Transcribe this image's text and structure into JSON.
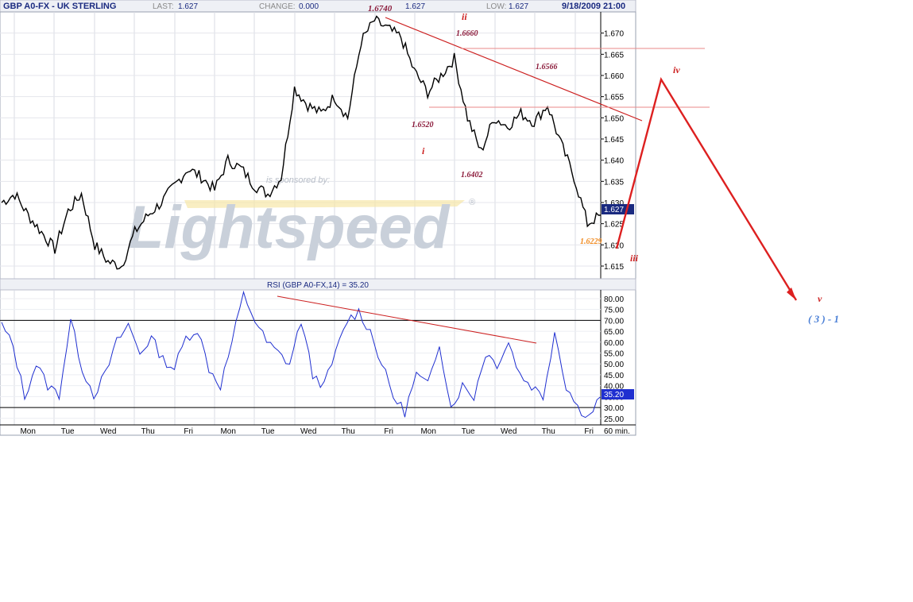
{
  "header": {
    "title": "GBP A0-FX - UK STERLING",
    "last_label": "LAST:",
    "last_value": "1.627",
    "change_label": "CHANGE:",
    "change_value": "0.000",
    "high_value": "1.627",
    "low_label": "LOW:",
    "low_value": "1.627",
    "datetime": "9/18/2009 21:00"
  },
  "watermark": {
    "text": "Lightspeed",
    "sponsored": "is sponsored by:",
    "reg": "®"
  },
  "price_axis": {
    "ticks": [
      "1.670",
      "1.665",
      "1.660",
      "1.655",
      "1.650",
      "1.645",
      "1.640",
      "1.635",
      "1.630",
      "1.625",
      "1.620",
      "1.615"
    ],
    "last_badge": "1.627"
  },
  "rsi": {
    "title": "RSI (GBP A0-FX,14) = 35.20",
    "ticks": [
      "80.00",
      "75.00",
      "70.00",
      "65.00",
      "60.00",
      "55.00",
      "50.00",
      "45.00",
      "40.00",
      "35.00",
      "30.00",
      "25.00"
    ],
    "badge": "35.20"
  },
  "days": [
    "Mon",
    "Tue",
    "Wed",
    "Thu",
    "Fri",
    "Mon",
    "Tue",
    "Wed",
    "Thu",
    "Fri",
    "Mon",
    "Tue",
    "Wed",
    "Thu",
    "Fri"
  ],
  "interval": "60 min.",
  "annotations": {
    "p1": "1.6740",
    "p2": "1.6660",
    "p3": "1.6566",
    "p4": "1.6520",
    "p5": "1.6402",
    "p6": "1.6229",
    "w_i": "i",
    "w_ii": "ii",
    "w_iii": "iii",
    "w_iv": "iv",
    "w_v": "v",
    "target": "( 3 ) - 1"
  },
  "colors": {
    "price": "#000000",
    "rsi": "#1f2fd0",
    "trend": "#cc1f1f",
    "badge": "#1a2a80"
  },
  "chart_data": [
    {
      "type": "line",
      "title": "GBP A0-FX - UK STERLING",
      "interval": "60 min.",
      "ylim": [
        1.612,
        1.675
      ],
      "x": [
        "Mon",
        "Tue",
        "Wed",
        "Thu",
        "Fri",
        "Mon",
        "Tue",
        "Wed",
        "Thu",
        "Fri",
        "Mon",
        "Tue",
        "Wed",
        "Thu",
        "Fri"
      ],
      "series": [
        {
          "values": [
            1.63,
            1.632,
            1.627,
            1.623,
            1.619,
            1.628,
            1.632,
            1.62,
            1.616,
            1.615,
            1.623,
            1.627,
            1.63,
            1.634,
            1.638,
            1.636,
            1.633,
            1.64,
            1.638,
            1.634,
            1.632,
            1.636,
            1.657,
            1.653,
            1.651,
            1.655,
            1.65,
            1.668,
            1.673,
            1.671,
            1.669,
            1.661,
            1.656,
            1.66,
            1.664,
            1.65,
            1.642,
            1.65,
            1.648,
            1.651,
            1.649,
            1.653,
            1.644,
            1.636,
            1.625,
            1.627
          ]
        }
      ],
      "levels": [
        1.674,
        1.666,
        1.6566,
        1.652,
        1.6402,
        1.6229
      ]
    },
    {
      "type": "line",
      "title": "RSI (GBP A0-FX,14) = 35.20",
      "ylim": [
        22,
        84
      ],
      "reference_lines": [
        70,
        30
      ],
      "series": [
        {
          "name": "RSI (GBP A0-FX,14)",
          "values": [
            68,
            58,
            35,
            50,
            40,
            36,
            70,
            48,
            36,
            45,
            60,
            68,
            55,
            62,
            52,
            48,
            62,
            66,
            48,
            40,
            60,
            82,
            70,
            60,
            55,
            50,
            70,
            45,
            40,
            55,
            70,
            74,
            65,
            50,
            35,
            28,
            45,
            40,
            60,
            30,
            40,
            35,
            55,
            50,
            60,
            45,
            40,
            35,
            65,
            40,
            30,
            26,
            35
          ]
        }
      ],
      "last": 35.2
    }
  ]
}
